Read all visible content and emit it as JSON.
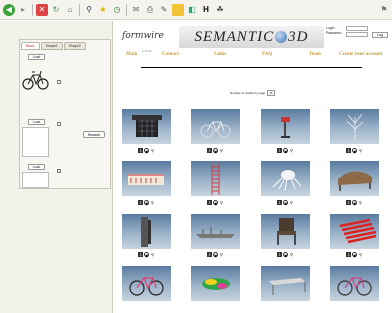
{
  "toolbar": {
    "icons": [
      "back-icon",
      "forward-icon",
      "stop-icon",
      "refresh-icon",
      "home-icon",
      "search-icon",
      "favorites-icon",
      "history-icon",
      "mail-icon",
      "print-icon",
      "edit-icon",
      "discuss-icon",
      "folder-icon",
      "messenger-icon",
      "translate-icon"
    ]
  },
  "left_panel": {
    "tabs": [
      "Basic",
      "Shape1",
      "Shape2"
    ],
    "load_label": "Load",
    "search_label": "Search"
  },
  "header": {
    "logo_script": "formwire",
    "logo_sub": "LIFE",
    "brand_left": "SEMANTIC",
    "brand_right": "3D",
    "login_label": "Login",
    "password_label": "Password",
    "login_button": "Log"
  },
  "nav": [
    "Main",
    "Contact",
    "Links",
    "FAQ",
    "Team",
    "Create your account"
  ],
  "results": {
    "per_page_label": "Number of results by page",
    "per_page_value": "16"
  },
  "thumbnails": [
    {
      "subject": "gazebo"
    },
    {
      "subject": "bicycle"
    },
    {
      "subject": "lamp"
    },
    {
      "subject": "tree"
    },
    {
      "subject": "building"
    },
    {
      "subject": "ladder"
    },
    {
      "subject": "spider"
    },
    {
      "subject": "bench"
    },
    {
      "subject": "pillar"
    },
    {
      "subject": "ship"
    },
    {
      "subject": "chair"
    },
    {
      "subject": "red-stairs"
    },
    {
      "subject": "bicycle-red"
    },
    {
      "subject": "colored-object"
    },
    {
      "subject": "table"
    },
    {
      "subject": "bicycle-pink"
    }
  ]
}
